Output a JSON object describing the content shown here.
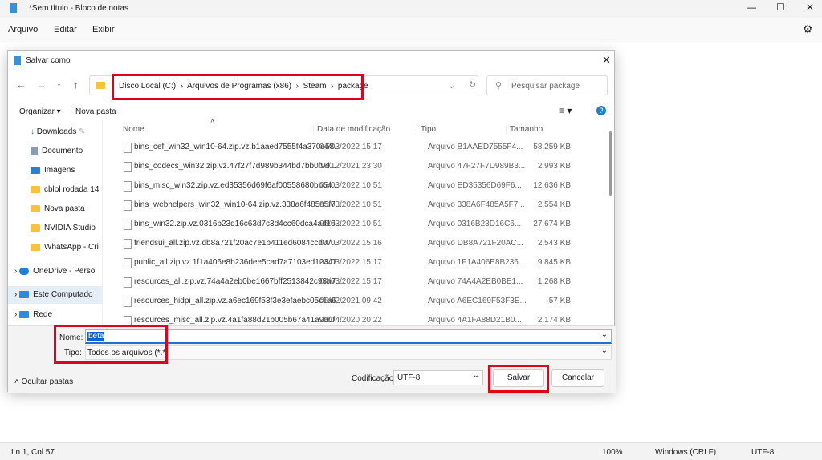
{
  "notepad": {
    "title": "*Sem título - Bloco de notas",
    "menu": [
      "Arquivo",
      "Editar",
      "Exibir"
    ],
    "status": {
      "position": "Ln 1, Col 57",
      "zoom": "100%",
      "line_ending": "Windows (CRLF)",
      "encoding": "UTF-8"
    }
  },
  "dialog": {
    "title": "Salvar como",
    "breadcrumb": [
      "Disco Local (C:)",
      "Arquivos de Programas (x86)",
      "Steam",
      "package"
    ],
    "search_placeholder": "Pesquisar package",
    "toolbar": {
      "organize": "Organizar ▾",
      "new_folder": "Nova pasta"
    },
    "sidebar": [
      "Downloads",
      "Documento",
      "Imagens",
      "cblol rodada 14",
      "Nova pasta",
      "NVIDIA Studio",
      "WhatsApp - Cri",
      "OneDrive - Perso",
      "Este Computado",
      "Rede"
    ],
    "columns": [
      "Nome",
      "Data de modificação",
      "Tipo",
      "Tamanho"
    ],
    "files": [
      [
        "bins_cef_win32_win10-64.zip.vz.b1aaed7555f4a370e58...",
        "04/03/2022 15:17",
        "Arquivo B1AAED7555F4...",
        "58.259 KB"
      ],
      [
        "bins_codecs_win32.zip.vz.47f27f7d989b344bd7bb0f9d...",
        "16/12/2021 23:30",
        "Arquivo 47F27F7D989B3...",
        "2.993 KB"
      ],
      [
        "bins_misc_win32.zip.vz.ed35356d69f6af00558680bb54...",
        "05/03/2022 10:51",
        "Arquivo ED35356D69F6...",
        "12.636 KB"
      ],
      [
        "bins_webhelpers_win32_win10-64.zip.vz.338a6f485a5f7...",
        "05/03/2022 10:51",
        "Arquivo 338A6F485A5F7...",
        "2.554 KB"
      ],
      [
        "bins_win32.zip.vz.0316b23d16c63d7c3d4cc60dca4ad15...",
        "05/03/2022 10:51",
        "Arquivo 0316B23D16C6...",
        "27.674 KB"
      ],
      [
        "friendsui_all.zip.vz.db8a721f20ac7e1b411ed6084ccd07...",
        "04/03/2022 15:16",
        "Arquivo DB8A721F20AC...",
        "2.543 KB"
      ],
      [
        "public_all.zip.vz.1f1a406e8b236dee5cad7a7103ed12347...",
        "04/03/2022 15:17",
        "Arquivo 1F1A406E8B236...",
        "9.845 KB"
      ],
      [
        "resources_all.zip.vz.74a4a2eb0be1667bff2513842c93a7...",
        "04/03/2022 15:17",
        "Arquivo 74A4A2EB0BE1...",
        "1.268 KB"
      ],
      [
        "resources_hidpi_all.zip.vz.a6ec169f53f3e3efaebc05c1a6...",
        "06/02/2021 09:42",
        "Arquivo A6EC169F53F3E...",
        "57 KB"
      ],
      [
        "resources_misc_all.zip.vz.4a1fa88d21b005b67a41a9a0f...",
        "20/04/2020 20:22",
        "Arquivo 4A1FA88D21B0...",
        "2.174 KB"
      ]
    ],
    "name_label": "Nome:",
    "name_value": "beta",
    "type_label": "Tipo:",
    "type_value": "Todos os arquivos  (*.*)",
    "hide_folders": "Ocultar pastas",
    "encoding_label": "Codificação:",
    "encoding_value": "UTF-8",
    "save": "Salvar",
    "cancel": "Cancelar"
  },
  "highlight_color": "#e0001b"
}
